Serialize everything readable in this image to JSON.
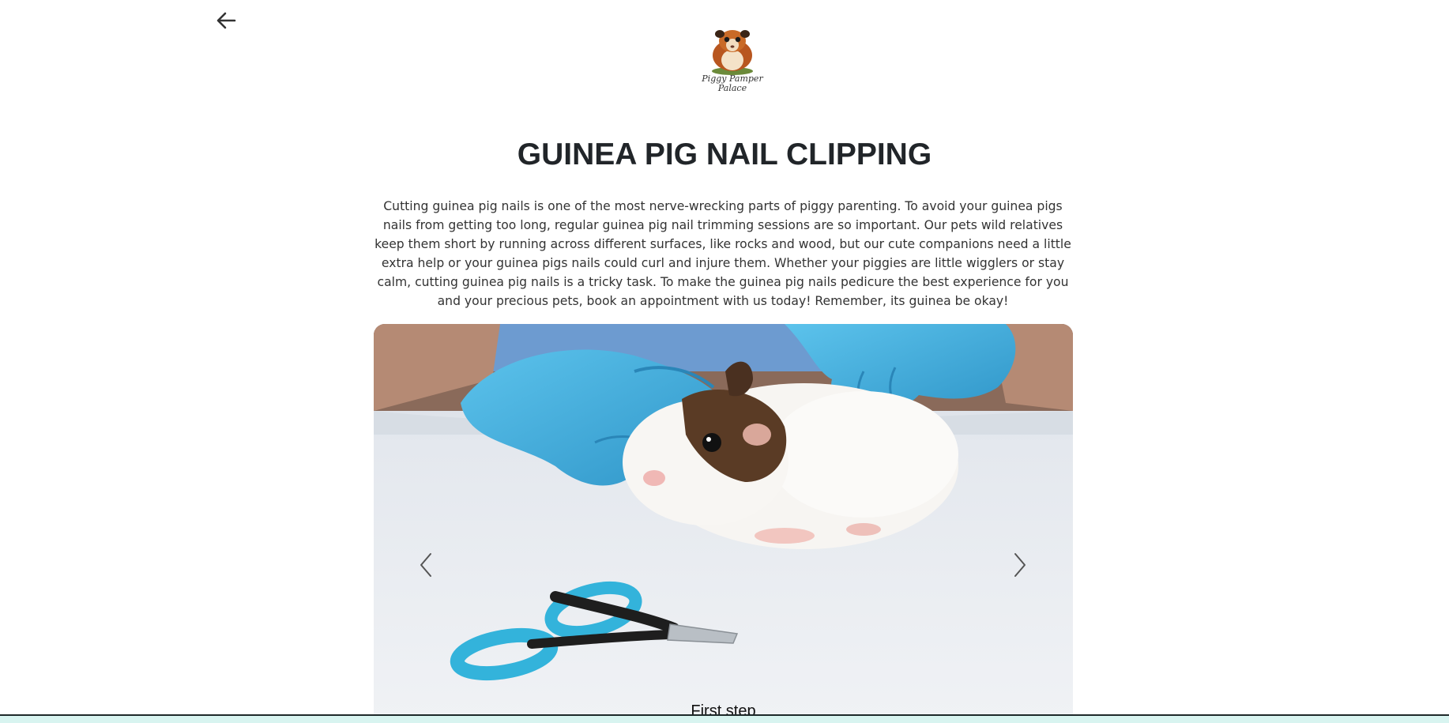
{
  "header": {
    "back_icon": "arrow-left-icon",
    "logo": {
      "line1": "Piggy Pamper",
      "line2": "Palace"
    }
  },
  "main": {
    "title": "GUINEA PIG NAIL CLIPPING",
    "description": "Cutting guinea pig nails is one of the most nerve-wrecking parts of piggy parenting. To avoid your guinea pigs nails from getting too long, regular guinea pig nail trimming sessions are so important. Our pets wild relatives keep them short by running across different surfaces, like rocks and wood, but our cute companions need a little extra help or your guinea pigs nails could curl and injure them. Whether your piggies are little wigglers or stay calm, cutting guinea pig nails is a tricky task. To make the guinea pig nails pedicure the best experience for you and your precious pets, book an appointment with us today! Remember, its guinea be okay!"
  },
  "carousel": {
    "prev_icon": "chevron-left-icon",
    "next_icon": "chevron-right-icon",
    "slide_caption": "First step"
  },
  "colors": {
    "glove": "#4fb6e3",
    "clipper": "#35b8dc",
    "bottom_bar": "#d8f4f0"
  }
}
